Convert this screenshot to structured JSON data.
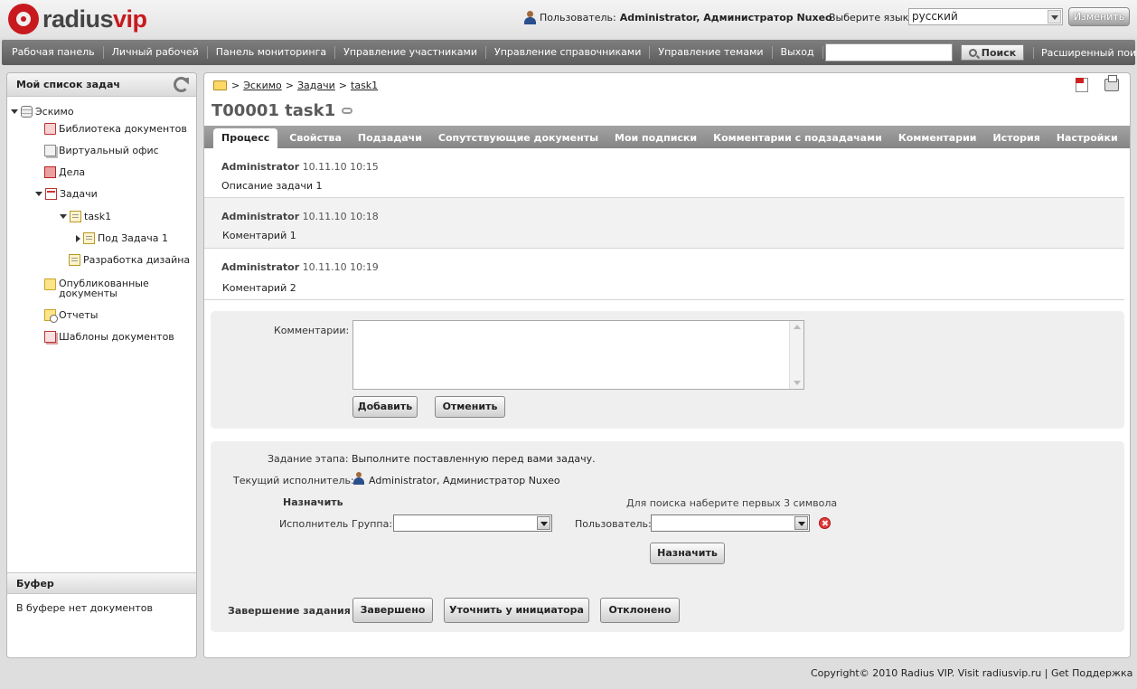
{
  "brand": {
    "logo_part1": "radius",
    "logo_part2": "vip",
    "brand_color": "#c8191f"
  },
  "header": {
    "user_label": "Пользователь:",
    "user_name": "Administrator, Администратор Nuxeo",
    "lang_label": "Выберите язык:",
    "lang_value": "русский",
    "change_button": "Изменить"
  },
  "nav": {
    "items": [
      "Рабочая панель",
      "Личный рабочей",
      "Панель мониторинга",
      "Управление участниками",
      "Управление справочниками",
      "Управление темами",
      "Выход"
    ],
    "search_button": "Поиск",
    "advanced_search": "Расширенный поиск"
  },
  "sidebar": {
    "title": "Мой список задач",
    "tree": [
      {
        "label": "Эскимо",
        "icon": "database-icon"
      },
      {
        "label": "Библиотека документов",
        "icon": "library-icon"
      },
      {
        "label": "Виртуальный офис",
        "icon": "virtual-office-icon"
      },
      {
        "label": "Дела",
        "icon": "cases-icon"
      },
      {
        "label": "Задачи",
        "icon": "tasks-icon"
      },
      {
        "label": "task1",
        "icon": "task-note-icon"
      },
      {
        "label": "Под Задача 1",
        "icon": "task-note-icon"
      },
      {
        "label": "Разработка дизайна",
        "icon": "task-note-icon"
      },
      {
        "label": "Опубликованные документы",
        "icon": "folder-icon"
      },
      {
        "label": "Отчеты",
        "icon": "reports-icon"
      },
      {
        "label": "Шаблоны документов",
        "icon": "templates-icon"
      }
    ],
    "buffer_title": "Буфер",
    "buffer_text": "В буфере нет документов"
  },
  "main": {
    "breadcrumb": [
      ">",
      "Эскимо",
      ">",
      "Задачи",
      ">",
      "task1"
    ],
    "title": "T00001 task1",
    "tabs": [
      "Процесс",
      "Свойства",
      "Подзадачи",
      "Сопутствующие документы",
      "Мои подписки",
      "Комментарии с подзадачами",
      "Комментарии",
      "История",
      "Настройки"
    ],
    "entries": [
      {
        "author": "Administrator",
        "date": "10.11.10 10:15",
        "text": "Описание задачи 1"
      },
      {
        "author": "Administrator",
        "date": "10.11.10 10:18",
        "text": "Коментарий 1"
      },
      {
        "author": "Administrator",
        "date": "10.11.10 10:19",
        "text": "Коментарий 2"
      }
    ],
    "comment_form": {
      "label": "Комментарии:",
      "value": "",
      "add_button": "Добавить",
      "cancel_button": "Отменить"
    },
    "stage": {
      "task_label": "Задание этапа:",
      "task_value": "Выполните поставленную перед вами задачу.",
      "assignee_label": "Текущий исполнитель:",
      "assignee_value": "Administrator, Администратор Nuxeo",
      "assign_heading": "Назначить",
      "search_hint": "Для поиска наберите первых 3 символа",
      "executor_label": "Исполнитель",
      "group_label": "Группа:",
      "group_value": "",
      "user_label": "Пользователь:",
      "user_value": "",
      "assign_button": "Назначить",
      "completion_label": "Завершение задания",
      "done_button": "Завершено",
      "clarify_button": "Уточнить у инициатора",
      "reject_button": "Отклонено"
    }
  },
  "footer": {
    "text": "Copyright© 2010 Radius VIP. Visit radiusvip.ru | Get Поддержка"
  }
}
